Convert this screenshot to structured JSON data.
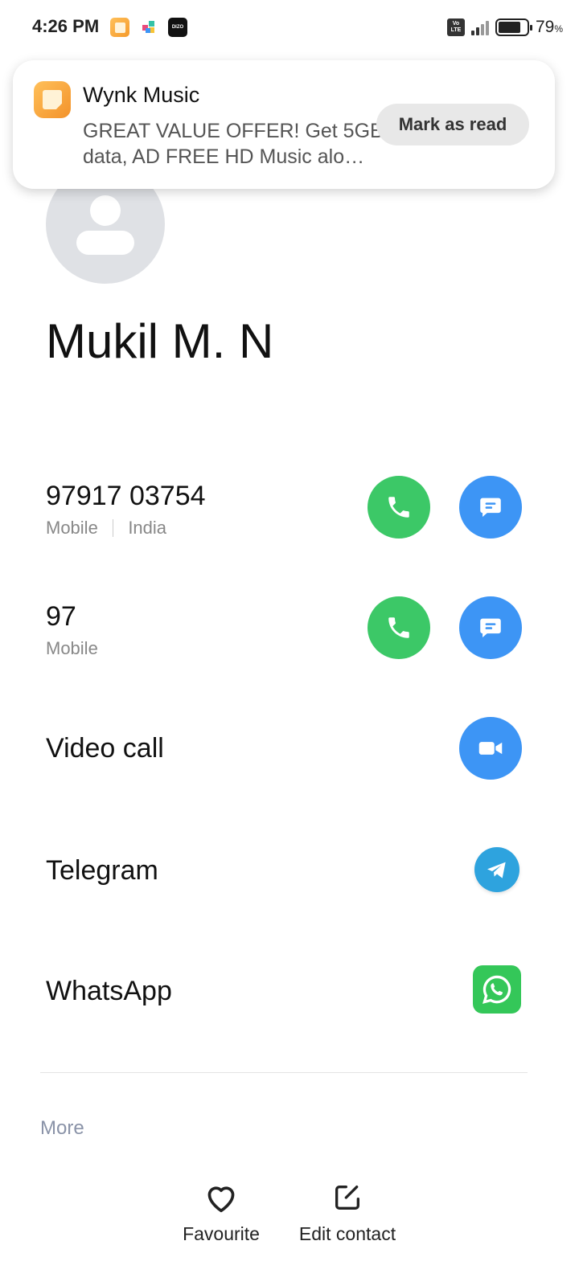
{
  "status_bar": {
    "time": "4:26 PM",
    "app_icons": [
      "wynk-icon",
      "puzzle-icon",
      "dizo-icon"
    ],
    "dizo_label": "DIZO",
    "volte_label": "Vo LTE",
    "battery_level": 0.79,
    "battery_percent": "79",
    "battery_unit": "%"
  },
  "notification": {
    "app_name": "Wynk Music",
    "body_line1": "GREAT VALUE OFFER! Get 5GB",
    "body_line2": "data, AD FREE HD Music alo…",
    "action_label": "Mark as read"
  },
  "contact": {
    "name": "Mukil M. N",
    "phones": [
      {
        "number": "97917 03754",
        "type": "Mobile",
        "region": "India"
      },
      {
        "number": "97",
        "type": "Mobile"
      }
    ],
    "video_call_label": "Video call",
    "telegram_label": "Telegram",
    "whatsapp_label": "WhatsApp"
  },
  "more_label": "More",
  "bottom_bar": {
    "favourite_label": "Favourite",
    "edit_label": "Edit contact"
  },
  "colors": {
    "call_green": "#3cc867",
    "message_blue": "#3d95f5",
    "telegram_blue": "#2ea3de",
    "whatsapp_green": "#34c759",
    "wynk_orange": "#f59a2b"
  }
}
